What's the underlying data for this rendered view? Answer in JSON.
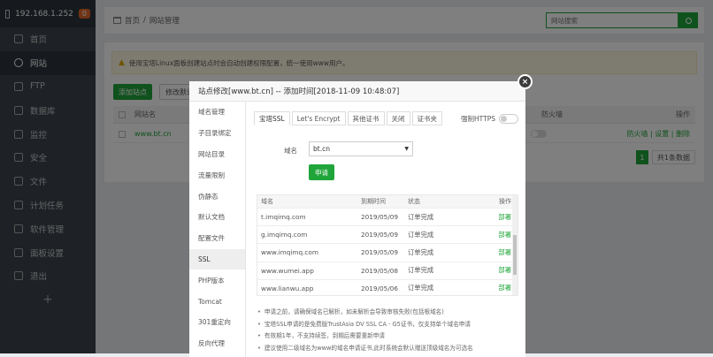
{
  "sidebar": {
    "server_ip": "192.168.1.252",
    "badge": "0",
    "items": [
      {
        "label": "首页",
        "icon": "home-icon"
      },
      {
        "label": "网站",
        "icon": "globe-icon"
      },
      {
        "label": "FTP",
        "icon": "ftp-icon"
      },
      {
        "label": "数据库",
        "icon": "database-icon"
      },
      {
        "label": "监控",
        "icon": "monitor-icon"
      },
      {
        "label": "安全",
        "icon": "shield-icon"
      },
      {
        "label": "文件",
        "icon": "folder-icon"
      },
      {
        "label": "计划任务",
        "icon": "clock-icon"
      },
      {
        "label": "软件管理",
        "icon": "apps-icon"
      },
      {
        "label": "面板设置",
        "icon": "gear-icon"
      },
      {
        "label": "退出",
        "icon": "logout-icon"
      }
    ],
    "add": "+"
  },
  "breadcrumb": {
    "home": "首页",
    "sep": "/",
    "current": "网站管理"
  },
  "search": {
    "placeholder": "网站搜索"
  },
  "panel": {
    "warning": "使用宝塔Linux面板创建站点时会自动创建权限配置，统一使用www用户。",
    "add_site": "添加站点",
    "modify_default": "修改默认页",
    "columns": {
      "name": "网站名",
      "firewall": "防火墙",
      "action": "操作"
    },
    "site_row": {
      "name": "www.bt.cn",
      "actions": "防火墙 | 设置 | 删除"
    },
    "page_current": "1",
    "page_total": "共1条数据"
  },
  "modal": {
    "title": "站点修改[www.bt.cn] -- 添加时间[2018-11-09 10:48:07]",
    "close": "×",
    "nav": [
      "域名管理",
      "子目录绑定",
      "网站目录",
      "流量限制",
      "伪静态",
      "默认文档",
      "配置文件",
      "SSL",
      "PHP版本",
      "Tomcat",
      "301重定向",
      "反向代理"
    ],
    "tabs": [
      "宝塔SSL",
      "Let's Encrypt",
      "其他证书",
      "关闭",
      "证书夹"
    ],
    "force_https": "强制HTTPS",
    "domain_label": "域名",
    "domain_value": "bt.cn",
    "apply_button": "申请",
    "table_headers": {
      "domain": "域名",
      "expire": "到期时间",
      "status": "状态",
      "action": "操作"
    },
    "rows": [
      {
        "domain": "t.imqimq.com",
        "expire": "2019/05/09",
        "status": "订单完成",
        "action": "部署"
      },
      {
        "domain": "g.imqimq.com",
        "expire": "2019/05/09",
        "status": "订单完成",
        "action": "部署"
      },
      {
        "domain": "www.imqimq.com",
        "expire": "2019/05/09",
        "status": "订单完成",
        "action": "部署"
      },
      {
        "domain": "www.wumei.app",
        "expire": "2019/05/08",
        "status": "订单完成",
        "action": "部署"
      },
      {
        "domain": "www.lianwu.app",
        "expire": "2019/05/06",
        "status": "订单完成",
        "action": "部署"
      }
    ],
    "notes": [
      "申请之前，请确保域名已解析，如未解析会导致审核失败(包括根域名)",
      "宝塔SSL申请的是免费版TrustAsia DV SSL CA - G5证书，仅支持单个域名申请",
      "有效期1年，不支持续签，到期后需要重新申请",
      "建议使用二级域名为www的域名申请证书,此时系统会默认赠送顶级域名为可选名"
    ]
  },
  "colors": {
    "accent": "#20a53a",
    "sidebar": "#3c444d"
  }
}
